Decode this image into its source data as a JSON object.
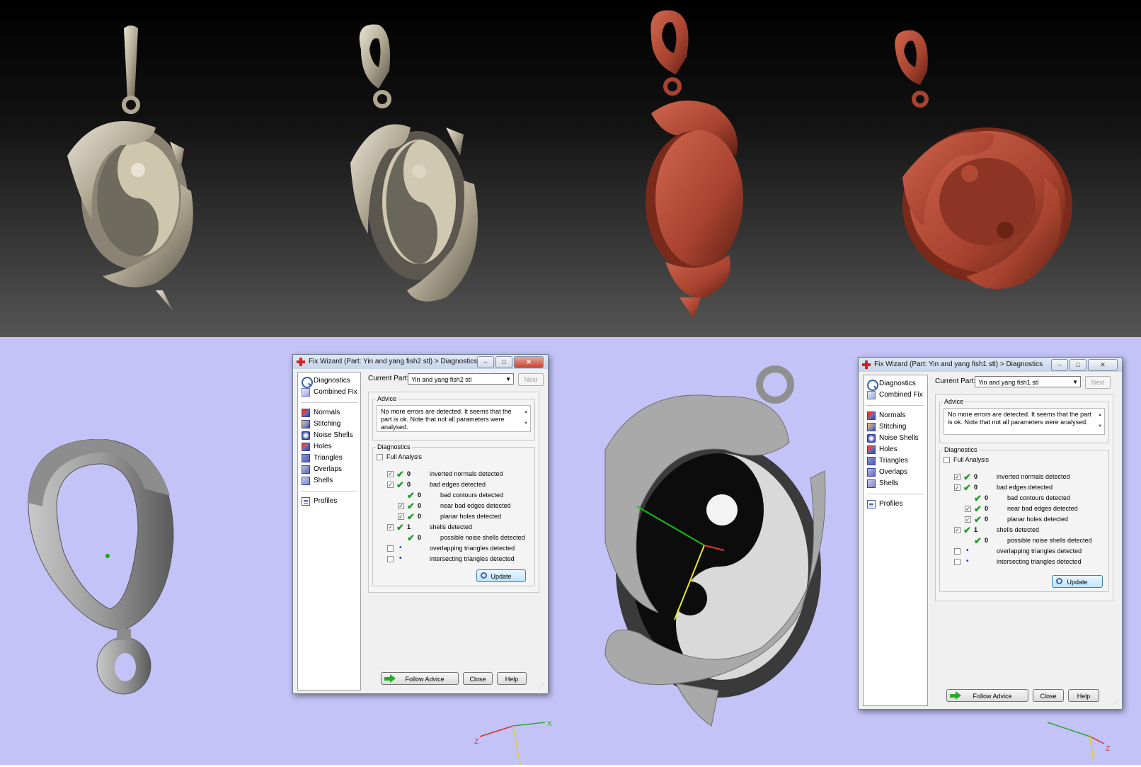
{
  "colors": {
    "viewport_bg": "#c3c3f7",
    "render_bg_top": "#000000",
    "render_bg_bottom": "#555555",
    "silver": "#b8b1a2",
    "wax": "#a8432f",
    "check_green": "#1a9a24",
    "dot_blue": "#1f3fa8",
    "app_cross_red": "#d81e1e"
  },
  "window_left": {
    "title": "Fix Wizard (Part: Yin and yang fish2 stl) > Diagnostics",
    "current_part_label": "Current Part:",
    "current_part_value": "Yin and yang fish2 stl",
    "next_label": "Next",
    "advice_legend": "Advice",
    "advice_text": "No more errors are detected. It seems that the part is ok. Note that not all parameters were analysed.",
    "diagnostics_legend": "Diagnostics",
    "full_analysis_label": "Full Analysis",
    "rows": [
      {
        "count": "0",
        "label": "inverted normals detected"
      },
      {
        "count": "0",
        "label": "bad edges detected"
      },
      {
        "count": "0",
        "label": "bad contours detected"
      },
      {
        "count": "0",
        "label": "near bad edges detected"
      },
      {
        "count": "0",
        "label": "planar holes detected"
      },
      {
        "count": "1",
        "label": "shells detected"
      },
      {
        "count": "0",
        "label": "possible noise shells detected"
      },
      {
        "count": "",
        "label": "overlapping triangles detected"
      },
      {
        "count": "",
        "label": "intersecting triangles detected"
      }
    ],
    "update_label": "Update",
    "follow_advice_label": "Follow Advice",
    "close_label": "Close",
    "help_label": "Help"
  },
  "window_right": {
    "title": "Fix Wizard (Part: Yin and yang fish1 stl) > Diagnostics",
    "current_part_label": "Current Part:",
    "current_part_value": "Yin and yang fish1 stl",
    "next_label": "Next",
    "advice_legend": "Advice",
    "advice_text": "No more errors are detected. It seems that the part is ok. Note that not all parameters were analysed.",
    "diagnostics_legend": "Diagnostics",
    "full_analysis_label": "Full Analysis",
    "rows": [
      {
        "count": "0",
        "label": "inverted normals detected"
      },
      {
        "count": "0",
        "label": "bad edges detected"
      },
      {
        "count": "0",
        "label": "bad contours detected"
      },
      {
        "count": "0",
        "label": "near bad edges detected"
      },
      {
        "count": "0",
        "label": "planar holes detected"
      },
      {
        "count": "1",
        "label": "shells detected"
      },
      {
        "count": "0",
        "label": "possible noise shells detected"
      },
      {
        "count": "",
        "label": "overlapping triangles detected"
      },
      {
        "count": "",
        "label": "intersecting triangles detected"
      }
    ],
    "update_label": "Update",
    "follow_advice_label": "Follow Advice",
    "close_label": "Close",
    "help_label": "Help"
  },
  "nav": {
    "diagnostics": "Diagnostics",
    "combined_fix": "Combined Fix",
    "normals": "Normals",
    "stitching": "Stitching",
    "noise_shells": "Noise Shells",
    "holes": "Holes",
    "triangles": "Triangles",
    "overlaps": "Overlaps",
    "shells": "Shells",
    "profiles": "Profiles"
  },
  "axis_left": {
    "x": "X",
    "z": "Z"
  },
  "axis_right": {
    "z": "Z"
  }
}
